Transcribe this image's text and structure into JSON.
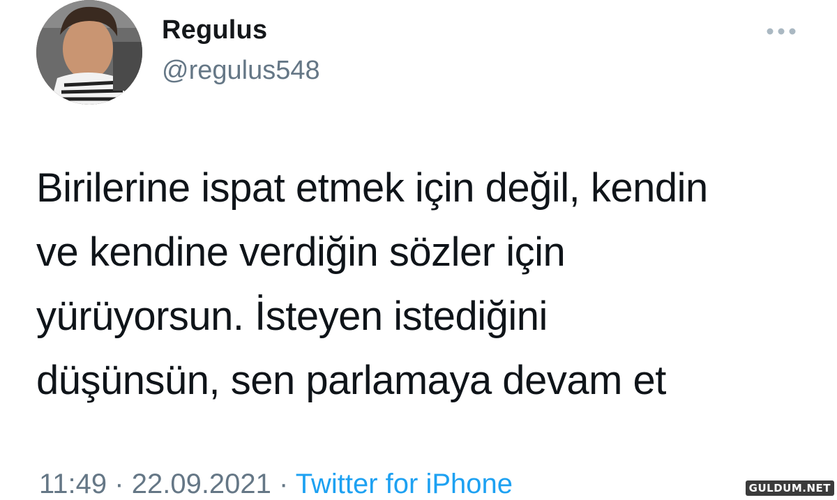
{
  "user": {
    "display_name": "Regulus",
    "handle": "@regulus548"
  },
  "menu": {
    "icon": "more-horizontal-icon"
  },
  "tweet": {
    "lines": [
      "Birilerine ispat etmek için değil, kendin",
      "ve kendine verdiğin sözler için",
      "yürüyorsun. İsteyen istediğini",
      "düşünsün, sen parlamaya devam et"
    ]
  },
  "meta": {
    "time": "11:49",
    "separator": "·",
    "date": "22.09.2021",
    "source": "Twitter for iPhone"
  },
  "watermark": "GULDUM.NET",
  "colors": {
    "text": "#0f1419",
    "secondary": "#657786",
    "link": "#1da1f2"
  }
}
